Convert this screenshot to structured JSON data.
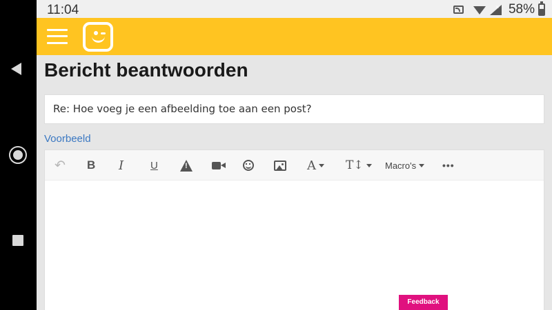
{
  "status_bar": {
    "time": "11:04",
    "battery": "58%",
    "icons": [
      "cast-icon",
      "wifi-icon",
      "signal-icon",
      "battery-icon"
    ]
  },
  "navigation": {
    "icons": [
      "back-icon",
      "home-icon",
      "recents-icon"
    ]
  },
  "app_bar": {
    "brand_color": "#ffc421",
    "icons": [
      "menu-icon",
      "telenet-logo-icon"
    ]
  },
  "page": {
    "title": "Bericht beantwoorden",
    "subject_value": "Re: Hoe voeg je een afbeelding toe aan een post?",
    "preview_link": "Voorbeeld"
  },
  "toolbar": {
    "bold": "B",
    "italic": "I",
    "underline": "U",
    "font": "A",
    "text_size": "T↕",
    "macros": "Macro's",
    "more": "•••",
    "icons": [
      "undo-icon",
      "bold-icon",
      "italic-icon",
      "underline-icon",
      "spoiler-warning-icon",
      "video-icon",
      "emoji-icon",
      "image-icon",
      "font-icon",
      "text-size-icon",
      "macros-dropdown",
      "more-icon"
    ]
  },
  "feedback": {
    "label": "Feedback",
    "color": "#e0117f"
  }
}
